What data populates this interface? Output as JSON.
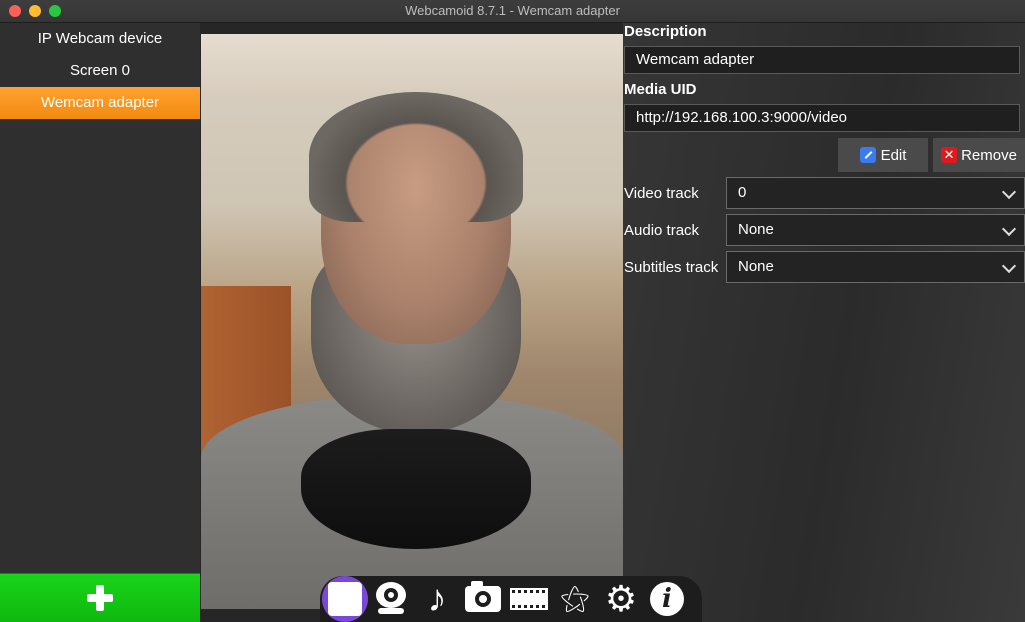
{
  "window": {
    "title": "Webcamoid 8.7.1 - Wemcam adapter"
  },
  "sidebar": {
    "devices": [
      {
        "label": "IP Webcam device",
        "selected": false
      },
      {
        "label": "Screen 0",
        "selected": false
      },
      {
        "label": "Wemcam adapter",
        "selected": true
      }
    ],
    "add_button_icon": "plus-icon"
  },
  "properties": {
    "description_label": "Description",
    "description_value": "Wemcam adapter",
    "media_uid_label": "Media UID",
    "media_uid_value": "http://192.168.100.3:9000/video",
    "edit_label": "Edit",
    "remove_label": "Remove",
    "video_track_label": "Video track",
    "video_track_value": "0",
    "audio_track_label": "Audio track",
    "audio_track_value": "None",
    "subtitles_track_label": "Subtitles track",
    "subtitles_track_value": "None"
  },
  "toolbar": {
    "items": [
      "stop-icon",
      "webcam-icon",
      "music-note-icon",
      "camera-icon",
      "film-icon",
      "magic-wand-icon",
      "gear-icon",
      "info-icon"
    ],
    "info_glyph": "i",
    "music_glyph": "♪",
    "wand_glyph": "⚝",
    "gear_glyph": "⚙"
  },
  "colors": {
    "selected": "#f7941d",
    "add": "#12c412",
    "active_tool": "#7a48d6"
  }
}
